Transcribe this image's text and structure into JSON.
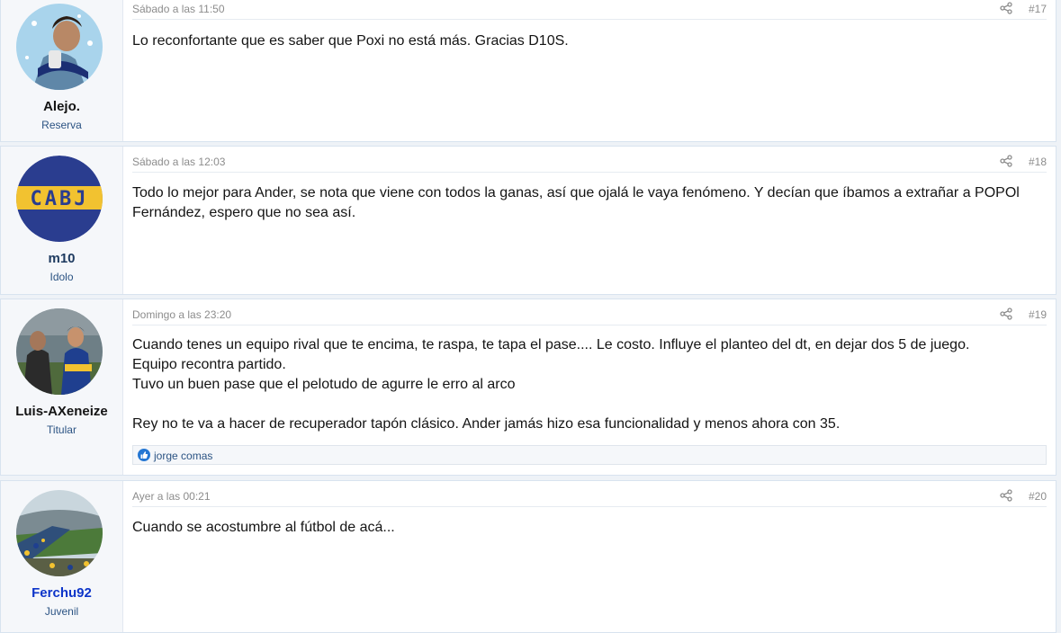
{
  "posts": [
    {
      "username": "Alejo.",
      "usertitle": "Reserva",
      "date": "Sábado a las 11:50",
      "number": "#17",
      "body": [
        "Lo reconfortante que es saber que Poxi no está más. Gracias D10S."
      ]
    },
    {
      "username": "m10",
      "usertitle": "Idolo",
      "avatar_text": "CABJ",
      "date": "Sábado a las 12:03",
      "number": "#18",
      "body": [
        "Todo lo mejor para Ander, se nota que viene con todos la ganas, así que ojalá le vaya fenómeno. Y decían que íbamos a extrañar a POPOl Fernández, espero que no sea así."
      ]
    },
    {
      "username": "Luis-AXeneize",
      "usertitle": "Titular",
      "date": "Domingo a las 23:20",
      "number": "#19",
      "body": [
        "Cuando tenes un equipo rival que te encima, te raspa, te tapa el pase.... Le costo. Influye el planteo del dt, en dejar dos 5 de juego.",
        "Equipo recontra partido.",
        "Tuvo un buen pase que el pelotudo de agurre le erro al arco",
        "",
        "Rey no te va a hacer de recuperador tapón clásico. Ander jamás hizo esa funcionalidad y menos ahora con 35."
      ],
      "reaction_user": "jorge comas"
    },
    {
      "username": "Ferchu92",
      "usertitle": "Juvenil",
      "date": "Ayer a las 00:21",
      "number": "#20",
      "body": [
        "Cuando se acostumbre al fútbol de acá..."
      ]
    }
  ]
}
